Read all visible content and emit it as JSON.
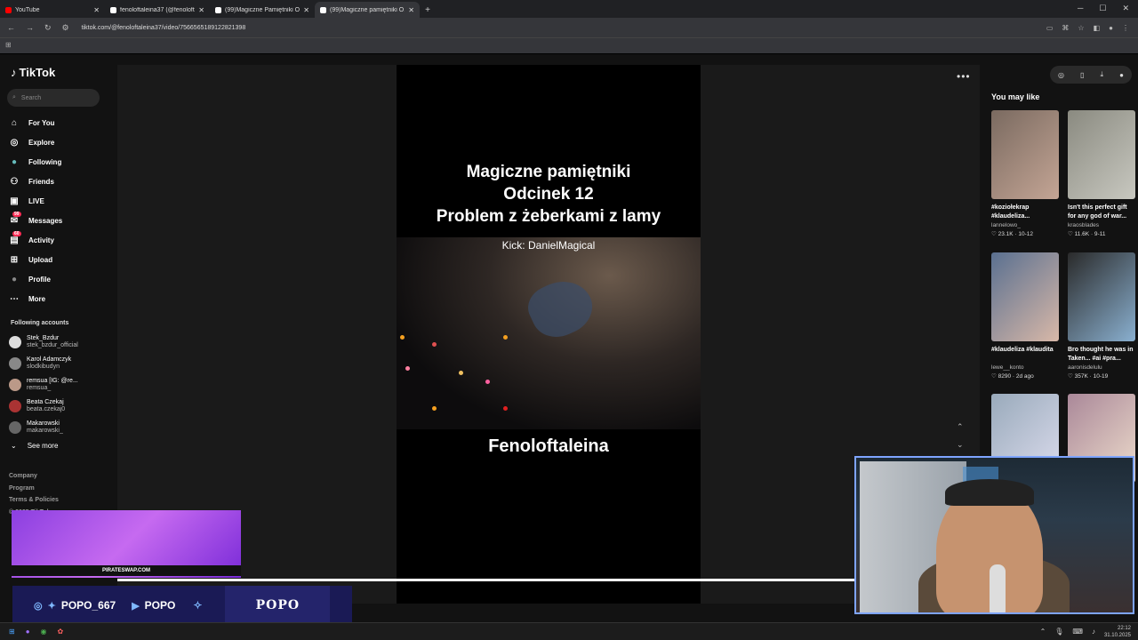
{
  "browser": {
    "tabs": [
      {
        "label": "YouTube",
        "color": "#ff0000",
        "active": false
      },
      {
        "label": "fenoloftaleina37 (@fenoloftalein...",
        "color": "#ffffff",
        "active": false
      },
      {
        "label": "(99)Magiczne Pamiętniki Odcin...",
        "color": "#ffffff",
        "active": false
      },
      {
        "label": "(99)Magiczne pamiętniki O...",
        "color": "#ffffff",
        "active": true
      }
    ],
    "url": "tiktok.com/@fenoloftaleina37/video/7566565189122821398"
  },
  "sidebar": {
    "logo": "TikTok",
    "search_placeholder": "Search",
    "menu": [
      {
        "label": "For You",
        "icon": "home-icon"
      },
      {
        "label": "Explore",
        "icon": "compass-icon"
      },
      {
        "label": "Following",
        "icon": "following-avatar-icon"
      },
      {
        "label": "Friends",
        "icon": "friends-icon"
      },
      {
        "label": "LIVE",
        "icon": "live-icon"
      },
      {
        "label": "Messages",
        "icon": "messages-icon",
        "badge": "99"
      },
      {
        "label": "Activity",
        "icon": "activity-icon",
        "badge": "60"
      },
      {
        "label": "Upload",
        "icon": "upload-icon"
      },
      {
        "label": "Profile",
        "icon": "profile-icon"
      },
      {
        "label": "More",
        "icon": "more-icon"
      }
    ],
    "following_title": "Following accounts",
    "following": [
      {
        "name": "Stek_Bzdur",
        "user": "stek_bzdur_official",
        "color": "#ddd"
      },
      {
        "name": "Karol Adamczyk",
        "user": "slodkibudyn",
        "color": "#888"
      },
      {
        "name": "remsua [IG: @re...",
        "user": "remsua_",
        "color": "#b98"
      },
      {
        "name": "Beata Czekaj",
        "user": "beata.czekaj0",
        "color": "#a33"
      },
      {
        "name": "Makarowski",
        "user": "makarowski_",
        "color": "#666"
      }
    ],
    "see_more": "See more",
    "footer": [
      "Company",
      "Program",
      "Terms & Policies",
      "© 2025 TikTok"
    ]
  },
  "video": {
    "title_lines": [
      "Magiczne pamiętniki",
      "Odcinek 12",
      "Problem z żeberkami z lamy"
    ],
    "kick": "Kick: DanielMagical",
    "name": "Fenoloftaleina",
    "more": "•••"
  },
  "right": {
    "title": "You may like",
    "cards": [
      {
        "caption": "#koziołekrap #klaudeliza...",
        "user": "lannelowo_",
        "stats": "♡ 23.1K · 10-12",
        "color1": "#7a6a60",
        "color2": "#c4a595"
      },
      {
        "caption": "Isn't this perfect gift for any god of war...",
        "user": "kraosblades",
        "stats": "♡ 11.6K · 9-11",
        "color1": "#8a8a80",
        "color2": "#c8c8c0"
      },
      {
        "caption": "#klaudeliza #klaudita",
        "user": "lewe__konto",
        "stats": "♡ 8290 · 2d ago",
        "color1": "#5a7090",
        "color2": "#d8b8a8"
      },
      {
        "caption": "Bro thought he was in Taken... #ai #pra...",
        "user": "aaronisdelulu",
        "stats": "♡ 357K · 10-19",
        "color1": "#2a2a2a",
        "color2": "#8ab0d0"
      },
      {
        "caption": "",
        "user": "",
        "stats": "",
        "color1": "#9ab",
        "color2": "#dde"
      },
      {
        "caption": "",
        "user": "",
        "stats": "",
        "color1": "#a89",
        "color2": "#edc"
      }
    ]
  },
  "overlay": {
    "site": "PIRATESWAP.COM",
    "social1": "POPO_667",
    "social2": "POPO",
    "brand": "POPO"
  },
  "taskbar": {
    "time": "22:12",
    "date": "31.10.2025"
  }
}
